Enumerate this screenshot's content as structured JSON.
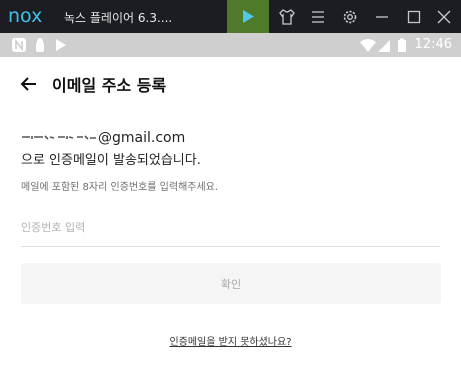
{
  "titlebar": {
    "logo": "nox",
    "title": "녹스 플레이어 6.3....",
    "icons": [
      "play-icon",
      "tshirt-icon",
      "menu-icon",
      "gear-icon",
      "minimize-icon",
      "maximize-icon",
      "close-icon"
    ],
    "accent": "#4f7a29"
  },
  "statusbar": {
    "time": "12:46",
    "icons": [
      "nox-notification-icon",
      "android-icon",
      "download-icon",
      "wifi-icon",
      "signal-icon",
      "battery-icon"
    ]
  },
  "page": {
    "title": "이메일 주소 등록",
    "email_domain": "@gmail.com",
    "sent_text": "으로 인증메일이 발송되었습니다.",
    "hint": "메일에 포함된 8자리 인증번호를 입력해주세요.",
    "code_placeholder": "인증번호 입력",
    "code_value": "",
    "confirm_label": "확인",
    "resend_link": "인증메일을 받지 못하셨나요?"
  }
}
